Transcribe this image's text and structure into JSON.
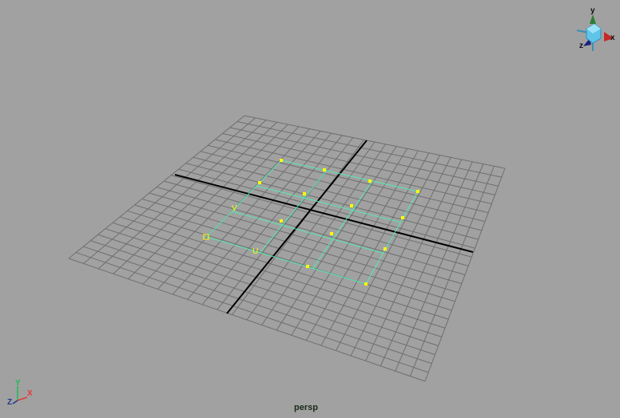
{
  "viewport": {
    "camera_label": "persp",
    "background_color": "#a1a1a1",
    "grid_color": "#6f6f6f",
    "axis_color": "#000000",
    "surface_color": "#55e8b0",
    "cv_color": "#ffff00"
  },
  "surface": {
    "u_label": "U",
    "v_label": "V"
  },
  "view_cube": {
    "x_label": "x",
    "y_label": "y",
    "z_label": "z"
  },
  "axis_triad": {
    "x_label": "X",
    "y_label": "Y",
    "z_label": "Z"
  }
}
